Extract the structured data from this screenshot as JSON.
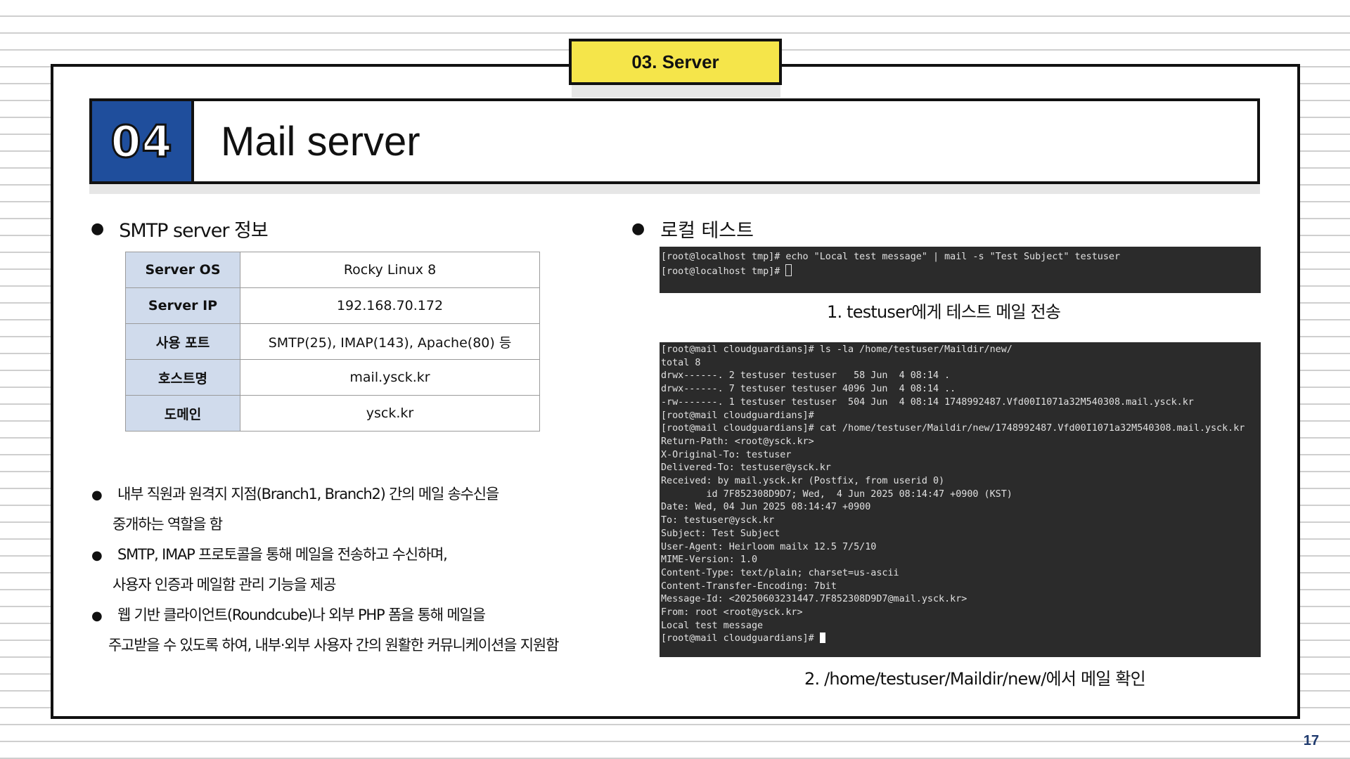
{
  "section_tab": "03. Server",
  "title": {
    "number": "04",
    "text": "Mail server"
  },
  "left": {
    "heading": "SMTP server 정보",
    "table": [
      {
        "key": "Server OS",
        "value": "Rocky Linux 8"
      },
      {
        "key": "Server IP",
        "value": "192.168.70.172"
      },
      {
        "key": "사용 포트",
        "value": "SMTP(25), IMAP(143), Apache(80) 등"
      },
      {
        "key": "호스트명",
        "value": "mail.ysck.kr"
      },
      {
        "key": "도메인",
        "value": "ysck.kr"
      }
    ],
    "bullets": [
      {
        "line1": "내부 직원과 원격지 지점(Branch1, Branch2) 간의 메일 송수신을",
        "line2": "중개하는 역할을 함"
      },
      {
        "line1": "SMTP, IMAP 프로토콜을 통해 메일을 전송하고 수신하며,",
        "line2": "사용자 인증과 메일함 관리 기능을 제공"
      },
      {
        "line1": "웹 기반 클라이언트(Roundcube)나 외부 PHP 폼을 통해 메일을",
        "line2": "주고받을 수 있도록 하여, 내부·외부 사용자 간의 원활한 커뮤니케이션을 지원함"
      }
    ]
  },
  "right": {
    "heading": "로컬 테스트",
    "terminal1": [
      "[root@localhost tmp]# echo \"Local test message\" | mail -s \"Test Subject\" testuser",
      "[root@localhost tmp]# "
    ],
    "caption1": "1. testuser에게 테스트 메일 전송",
    "terminal2": [
      "[root@mail cloudguardians]# ls -la /home/testuser/Maildir/new/",
      "total 8",
      "drwx------. 2 testuser testuser   58 Jun  4 08:14 .",
      "drwx------. 7 testuser testuser 4096 Jun  4 08:14 ..",
      "-rw-------. 1 testuser testuser  504 Jun  4 08:14 1748992487.Vfd00I1071a32M540308.mail.ysck.kr",
      "[root@mail cloudguardians]#",
      "[root@mail cloudguardians]# cat /home/testuser/Maildir/new/1748992487.Vfd00I1071a32M540308.mail.ysck.kr",
      "Return-Path: <root@ysck.kr>",
      "X-Original-To: testuser",
      "Delivered-To: testuser@ysck.kr",
      "Received: by mail.ysck.kr (Postfix, from userid 0)",
      "        id 7F852308D9D7; Wed,  4 Jun 2025 08:14:47 +0900 (KST)",
      "Date: Wed, 04 Jun 2025 08:14:47 +0900",
      "To: testuser@ysck.kr",
      "Subject: Test Subject",
      "User-Agent: Heirloom mailx 12.5 7/5/10",
      "MIME-Version: 1.0",
      "Content-Type: text/plain; charset=us-ascii",
      "Content-Transfer-Encoding: 7bit",
      "Message-Id: <20250603231447.7F852308D9D7@mail.ysck.kr>",
      "From: root <root@ysck.kr>",
      "",
      "Local test message",
      "[root@mail cloudguardians]# "
    ],
    "caption2": "2. /home/testuser/Maildir/new/에서 메일 확인"
  },
  "page_number": "17",
  "colors": {
    "accent_yellow": "#f5e54a",
    "number_blue": "#1f4e9c",
    "table_key_bg": "#d0dbec",
    "terminal_bg": "#2b2b2b"
  }
}
